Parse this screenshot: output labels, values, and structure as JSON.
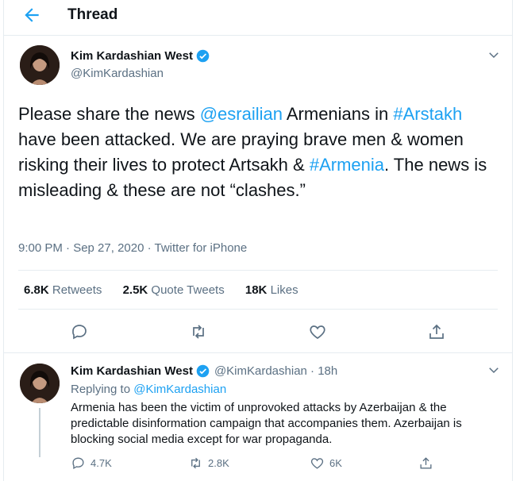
{
  "header": {
    "title": "Thread",
    "back_icon": "arrow-left-icon"
  },
  "colors": {
    "accent": "#1da1f2",
    "muted": "#5b7083",
    "text": "#0f1419",
    "border": "#e6ecf0"
  },
  "tweet": {
    "author_name": "Kim Kardashian West",
    "author_handle": "@KimKardashian",
    "verified_icon": "verified-badge-icon",
    "text_parts": {
      "p1": "Please share the news ",
      "mention": "@esrailian",
      "p2": " Armenians in ",
      "tag1": "#Arstakh",
      "p3": " have been attacked. We are praying brave men & women risking their lives to protect Artsakh & ",
      "tag2": "#Armenia",
      "p4": ". The news is misleading & these are not “clashes.”"
    },
    "meta": "9:00 PM · Sep 27, 2020 · Twitter for iPhone",
    "stats": {
      "retweets_count": "6.8K",
      "retweets_label": "Retweets",
      "quotes_count": "2.5K",
      "quotes_label": "Quote Tweets",
      "likes_count": "18K",
      "likes_label": "Likes"
    }
  },
  "reply": {
    "author_name": "Kim Kardashian West",
    "handle_time": "@KimKardashian · 18h",
    "replying_prefix": "Replying to ",
    "replying_handle": "@KimKardashian",
    "text": "Armenia has been the victim of unprovoked attacks by Azerbaijan & the predictable disinformation campaign that accompanies them. Azerbaijan is blocking social media except for war propaganda.",
    "counts": {
      "replies": "4.7K",
      "retweets": "2.8K",
      "likes": "6K"
    }
  }
}
